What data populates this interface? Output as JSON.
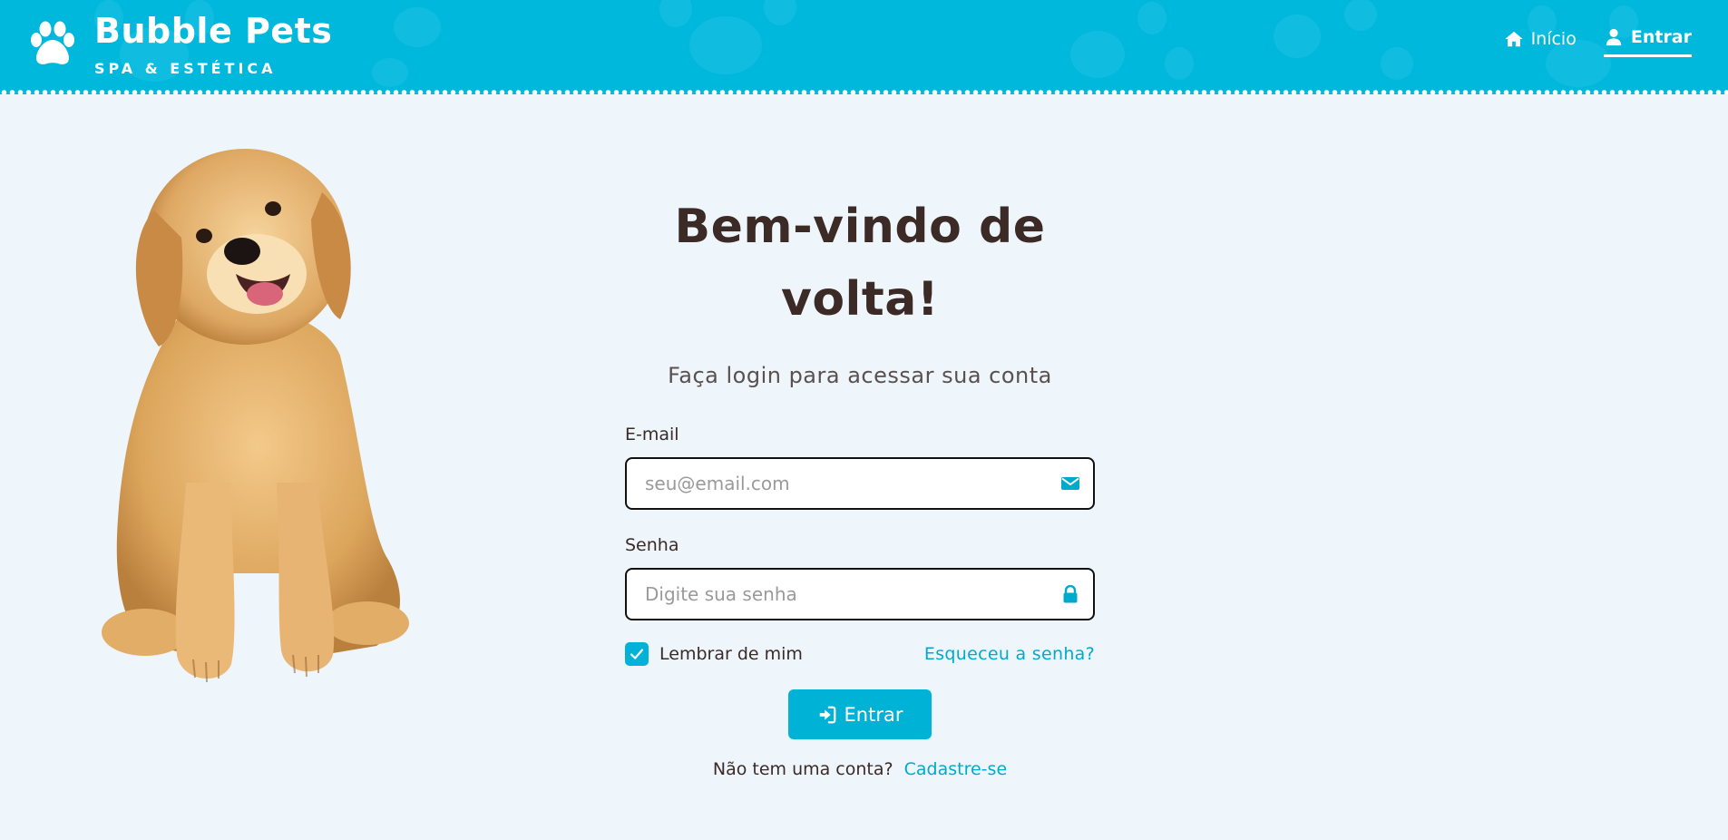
{
  "header": {
    "brand_name": "Bubble Pets",
    "brand_tagline": "SPA & ESTÉTICA",
    "nav": [
      {
        "label": "Início",
        "icon": "home-icon",
        "active": false
      },
      {
        "label": "Entrar",
        "icon": "user-icon",
        "active": true
      }
    ]
  },
  "login": {
    "title": "Bem-vindo de volta!",
    "subtitle": "Faça login para acessar sua conta",
    "email": {
      "label": "E-mail",
      "placeholder": "seu@email.com",
      "value": "",
      "icon": "envelope-icon"
    },
    "password": {
      "label": "Senha",
      "placeholder": "Digite sua senha",
      "value": "",
      "icon": "lock-icon"
    },
    "remember_label": "Lembrar de mim",
    "remember_checked": true,
    "forgot_label": "Esqueceu a senha?",
    "submit_label": "Entrar",
    "submit_icon": "sign-in-icon",
    "no_account_text": "Não tem uma conta?",
    "signup_label": "Cadastre-se"
  },
  "colors": {
    "header_bg": "#00b7dc",
    "accent": "#00b3d6",
    "page_bg": "#eef6fc",
    "heading_text": "#3b2a26"
  }
}
